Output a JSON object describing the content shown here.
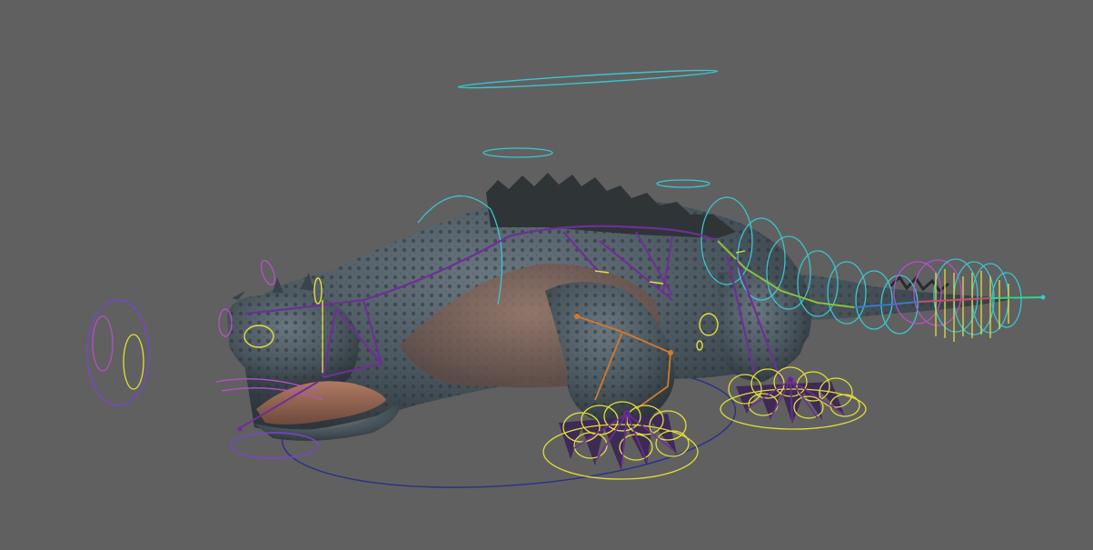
{
  "viewport": {
    "background": "#606060",
    "subject": "rigged-creature"
  },
  "colors": {
    "skin_dark": "#3f4a52",
    "skin_mid": "#56636c",
    "belly": "#8a6a5e",
    "spine": "#2f3437",
    "cyan_ctrl": "#39c6cf",
    "yellow_ctrl": "#e2df3a",
    "purple_ctrl": "#6e2f96",
    "magenta_ctrl": "#b84fc9",
    "orange_ctrl": "#d07a30",
    "navy_ctrl": "#2a2f8a",
    "violet_ctrl": "#7a45c8"
  },
  "icons": {
    "root": "root-control-circle",
    "world": "world-control-line",
    "foot": "foot-ik-control",
    "tail": "tail-fk-controls",
    "eye": "eye-look-control"
  }
}
